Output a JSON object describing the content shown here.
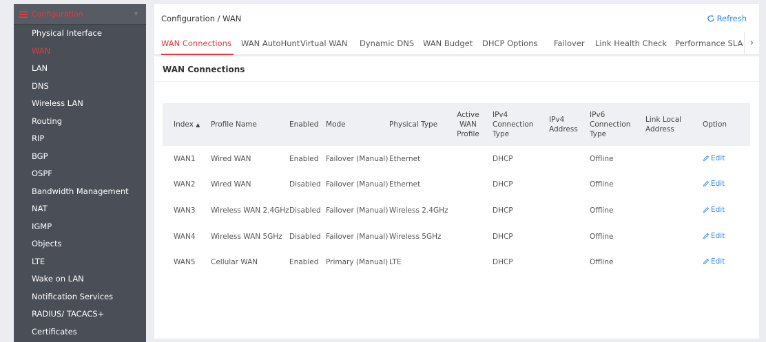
{
  "sidebar": {
    "header": "Configuration",
    "items": [
      {
        "label": "Physical Interface",
        "active": false
      },
      {
        "label": "WAN",
        "active": true
      },
      {
        "label": "LAN",
        "active": false
      },
      {
        "label": "DNS",
        "active": false
      },
      {
        "label": "Wireless LAN",
        "active": false
      },
      {
        "label": "Routing",
        "active": false
      },
      {
        "label": "RIP",
        "active": false
      },
      {
        "label": "BGP",
        "active": false
      },
      {
        "label": "OSPF",
        "active": false
      },
      {
        "label": "Bandwidth Management",
        "active": false
      },
      {
        "label": "NAT",
        "active": false
      },
      {
        "label": "IGMP",
        "active": false
      },
      {
        "label": "Objects",
        "active": false
      },
      {
        "label": "LTE",
        "active": false
      },
      {
        "label": "Wake on LAN",
        "active": false
      },
      {
        "label": "Notification Services",
        "active": false
      },
      {
        "label": "RADIUS/ TACACS+",
        "active": false
      },
      {
        "label": "Certificates",
        "active": false
      }
    ]
  },
  "breadcrumb": "Configuration / WAN",
  "refresh_label": "Refresh",
  "tabs": [
    {
      "label": "WAN Connections",
      "active": true
    },
    {
      "label": "WAN AutoHunt",
      "active": false
    },
    {
      "label": "Virtual WAN",
      "active": false
    },
    {
      "label": "Dynamic DNS",
      "active": false
    },
    {
      "label": "WAN Budget",
      "active": false
    },
    {
      "label": "DHCP Options",
      "active": false
    },
    {
      "label": "Failover",
      "active": false
    },
    {
      "label": "Link Health Check",
      "active": false
    },
    {
      "label": "Performance SLA",
      "active": false
    }
  ],
  "panel_title": "WAN Connections",
  "table": {
    "columns": [
      "Index",
      "Profile Name",
      "Enabled",
      "Mode",
      "Physical Type",
      "Active WAN Profile",
      "IPv4 Connection Type",
      "IPv4 Address",
      "IPv6 Connection Type",
      "Link Local Address",
      "Option"
    ],
    "sort_indicator": "▲",
    "edit_label": "Edit",
    "rows": [
      {
        "index": "WAN1",
        "profile": "Wired WAN",
        "enabled": "Enabled",
        "mode": "Failover (Manual)",
        "physical": "Ethernet",
        "active": "",
        "ipv4type": "DHCP",
        "ipv4addr": "",
        "ipv6type": "Offline",
        "linklocal": ""
      },
      {
        "index": "WAN2",
        "profile": "Wired WAN",
        "enabled": "Disabled",
        "mode": "Failover (Manual)",
        "physical": "Ethernet",
        "active": "",
        "ipv4type": "DHCP",
        "ipv4addr": "",
        "ipv6type": "Offline",
        "linklocal": ""
      },
      {
        "index": "WAN3",
        "profile": "Wireless WAN 2.4GHz",
        "enabled": "Disabled",
        "mode": "Failover (Manual)",
        "physical": "Wireless 2.4GHz",
        "active": "",
        "ipv4type": "DHCP",
        "ipv4addr": "",
        "ipv6type": "Offline",
        "linklocal": ""
      },
      {
        "index": "WAN4",
        "profile": "Wireless WAN 5GHz",
        "enabled": "Disabled",
        "mode": "Failover (Manual)",
        "physical": "Wireless 5GHz",
        "active": "",
        "ipv4type": "DHCP",
        "ipv4addr": "",
        "ipv6type": "Offline",
        "linklocal": ""
      },
      {
        "index": "WAN5",
        "profile": "Cellular WAN",
        "enabled": "Enabled",
        "mode": "Primary (Manual)",
        "physical": "LTE",
        "active": "",
        "ipv4type": "DHCP",
        "ipv4addr": "",
        "ipv6type": "Offline",
        "linklocal": ""
      }
    ]
  },
  "colors": {
    "accent": "#e23b3b",
    "link": "#2e86de",
    "sidebar_bg": "#4a4f57"
  }
}
